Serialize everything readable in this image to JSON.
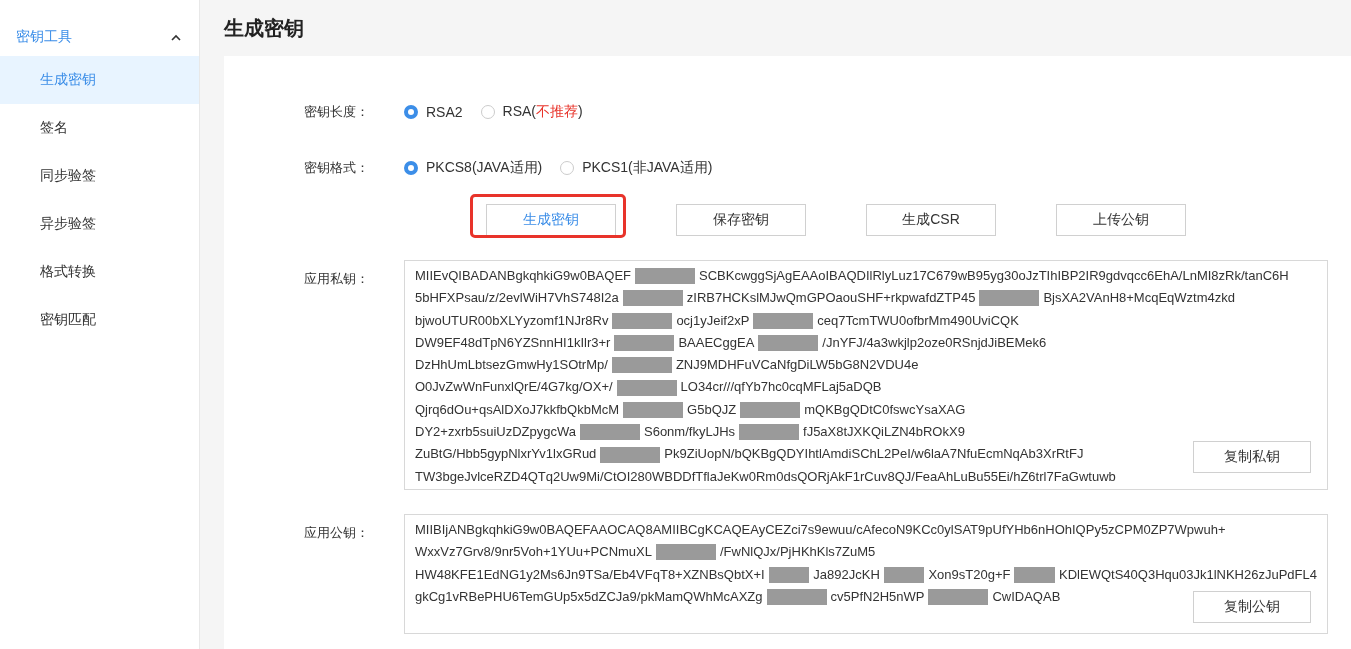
{
  "sidebar": {
    "group": {
      "label": "密钥工具",
      "expanded": true
    },
    "items": [
      {
        "label": "生成密钥",
        "selected": true
      },
      {
        "label": "签名",
        "selected": false
      },
      {
        "label": "同步验签",
        "selected": false
      },
      {
        "label": "异步验签",
        "selected": false
      },
      {
        "label": "格式转换",
        "selected": false
      },
      {
        "label": "密钥匹配",
        "selected": false
      }
    ]
  },
  "page_title": "生成密钥",
  "options": [
    {
      "label": "密钥长度：",
      "choices": [
        {
          "label": "RSA2",
          "selected": true
        },
        {
          "label": "RSA(",
          "note": "不推荐",
          "suffix": ")",
          "selected": false
        }
      ]
    },
    {
      "label": "密钥格式：",
      "choices": [
        {
          "label": "PKCS8(JAVA适用)",
          "selected": true
        },
        {
          "label": "PKCS1(非JAVA适用)",
          "selected": false
        }
      ]
    }
  ],
  "buttons": [
    {
      "label": "生成密钥",
      "highlighted": true
    },
    {
      "label": "保存密钥",
      "highlighted": false
    },
    {
      "label": "生成CSR",
      "highlighted": false
    },
    {
      "label": "上传公钥",
      "highlighted": false
    }
  ],
  "keys": [
    {
      "label": "应用私钥：",
      "copy_button": "复制私钥",
      "lines": [
        [
          "MIIEvQIBADANBgkqhkiG9w0BAQEF",
          "SCBKcwggSjAgEAAoIBAQDIlRlyLuz17C679wB95yg30oJzTIhIBP2IR9gdvqcc6EhA/LnMI8zRk/tanC6H"
        ],
        [
          "5bHFXPsau/z/2evlWiH7VhS748I2a",
          "zIRB7HCKslMJwQmGPOaouSHF+rkpwafdZTP45",
          "BjsXA2VAnH8+McqEqWztm4zkd"
        ],
        [
          "bjwoUTUR00bXLYyzomf1NJr8Rv",
          "ocj1yJeif2xP",
          "ceq7TcmTWU0ofbrMm490UviCQK"
        ],
        [
          "DW9EF48dTpN6YZSnnHI1kIlr3+r",
          "BAAECggEA",
          "/JnYFJ/4a3wkjlp2oze0RSnjdJiBEMek6"
        ],
        [
          "DzHhUmLbtsezGmwHy1SOtrMp/",
          "ZNJ9MDHFuVCaNfgDiLW5bG8N2VDU4e"
        ],
        [
          "O0JvZwWnFunxlQrE/4G7kg/OX+/",
          "LO34cr///qfYb7hc0cqMFLaj5aDQB"
        ],
        [
          "Qjrq6dOu+qsAlDXoJ7kkfbQkbMcM",
          "G5bQJZ",
          "mQKBgQDtC0fswcYsaXAG"
        ],
        [
          "DY2+zxrb5suiUzDZpygcWa",
          "S6onm/fkyLJHs",
          "fJ5aX8tJXKQiLZN4bROkX9"
        ],
        [
          "ZuBtG/Hbb5gypNlxrYv1lxGRud",
          "Pk9ZiUopN/bQKBgQDYIhtlAmdiSChL2PeI/w6laA7NfuEcmNqAb3XrRtFJ"
        ],
        [
          "TW3bgeJvlceRZD4QTq2Uw9Mi/CtOI280WBDDfTflaJeKw0Rm0dsQORjAkF1rCuv8QJ/FeaAhLuBu55Ei/hZ6trl7FaGwtuwb"
        ]
      ]
    },
    {
      "label": "应用公钥：",
      "copy_button": "复制公钥",
      "lines": [
        [
          "MIIBIjANBgkqhkiG9w0BAQEFAAOCAQ8AMIIBCgKCAQEAyCEZci7s9ewuu/cAfecoN9KCc0ylSAT9pUfYHb6nHOhIQPy5zCPM0ZP7Wpwuh+"
        ],
        [
          "WxxVz7Grv8/9nr5Voh+1YUu+PCNmuXL",
          "/FwNlQJx/PjHKhKls7ZuM5"
        ],
        [
          "HW48KFE1EdNG1y2Ms6Jn9TSa/Eb4VFqT8+XZNBsQbtX+I",
          "Ja892JcKH",
          "Xon9sT20g+F",
          "KDlEWQtS40Q3Hqu03Jk1lNKH26zJuPdFL4"
        ],
        [
          "gkCg1vRBePHU6TemGUp5x5dZCJa9/pkMamQWhMcAXZg",
          "cv5PfN2H5nWP",
          "CwIDAQAB"
        ]
      ]
    }
  ]
}
